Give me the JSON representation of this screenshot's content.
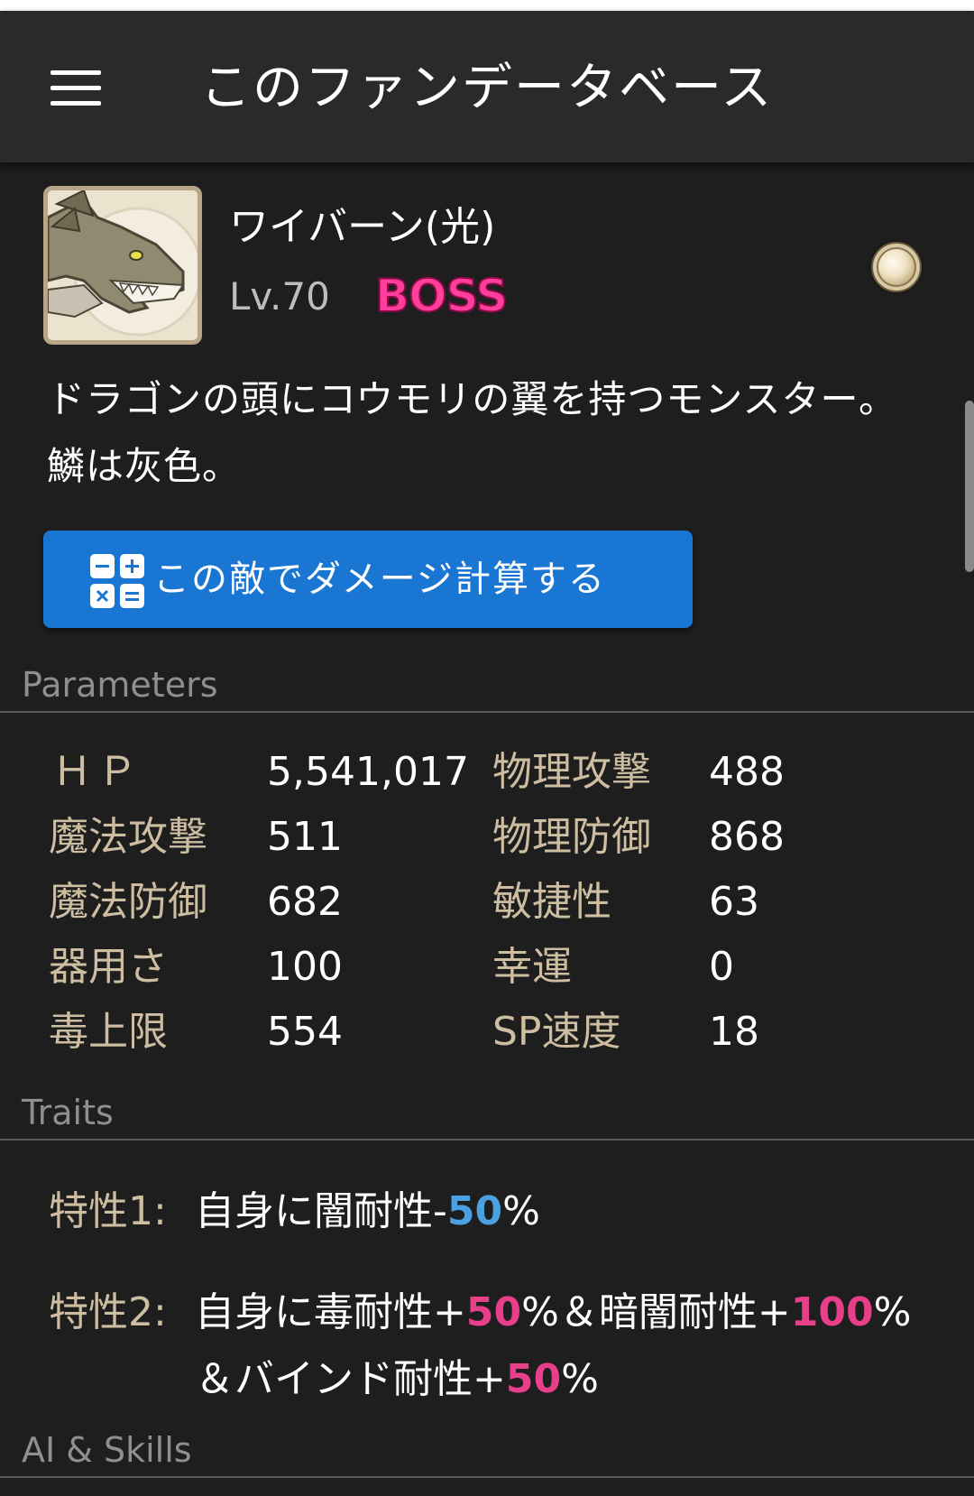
{
  "app": {
    "title": "このファンデータベース"
  },
  "enemy": {
    "name": "ワイバーン(光)",
    "level": "Lv.70",
    "badge": "BOSS",
    "element_icon": "light-element-orb-icon",
    "portrait_icon": "wyvern-portrait-icon",
    "description": "ドラゴンの頭にコウモリの翼を持つモンスター。鱗は灰色。"
  },
  "actions": {
    "calc_label": "この敵でダメージ計算する",
    "calc_icon": "calculator-icon"
  },
  "sections": {
    "parameters": "Parameters",
    "traits": "Traits",
    "ai_skills": "AI & Skills"
  },
  "stats": [
    {
      "label": "ＨＰ",
      "value": "5,541,017"
    },
    {
      "label": "物理攻撃",
      "value": "488"
    },
    {
      "label": "魔法攻撃",
      "value": "511"
    },
    {
      "label": "物理防御",
      "value": "868"
    },
    {
      "label": "魔法防御",
      "value": "682"
    },
    {
      "label": "敏捷性",
      "value": "63"
    },
    {
      "label": "器用さ",
      "value": "100"
    },
    {
      "label": "幸運",
      "value": "0"
    },
    {
      "label": "毒上限",
      "value": "554"
    },
    {
      "label": "SP速度",
      "value": "18"
    }
  ],
  "traits": [
    {
      "label": "特性1:",
      "parts": [
        "自身に闇耐性-",
        "50",
        "%"
      ]
    },
    {
      "label": "特性2:",
      "parts": [
        "自身に毒耐性+",
        "50",
        "%＆暗闇耐性+",
        "100",
        "%＆バインド耐性+",
        "50",
        "%"
      ]
    }
  ],
  "colors": {
    "background": "#1e1e1e",
    "app_bar": "#2a2a2a",
    "accent_button": "#1976d2",
    "boss_badge": "#ff3f9b",
    "stat_label": "#cdbda1",
    "negative_value": "#4aa0e0",
    "positive_value": "#e83f8a"
  }
}
